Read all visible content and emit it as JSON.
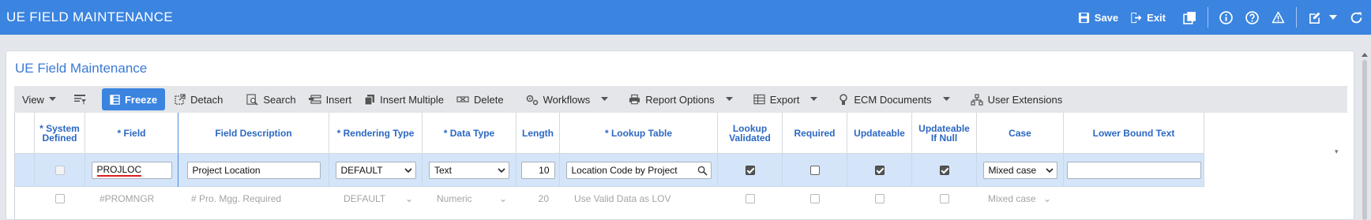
{
  "app": {
    "title": "UE FIELD MAINTENANCE"
  },
  "topbar": {
    "save_label": "Save",
    "exit_label": "Exit"
  },
  "panel": {
    "title": "UE Field Maintenance"
  },
  "toolbar": {
    "view": "View",
    "freeze": "Freeze",
    "detach": "Detach",
    "search": "Search",
    "insert": "Insert",
    "insert_multiple": "Insert Multiple",
    "delete": "Delete",
    "workflows": "Workflows",
    "report_options": "Report Options",
    "export": "Export",
    "ecm_documents": "ECM Documents",
    "user_extensions": "User Extensions"
  },
  "grid": {
    "headers": {
      "system_defined": "* System Defined",
      "field": "* Field",
      "field_description": "Field Description",
      "rendering_type": "* Rendering Type",
      "data_type": "* Data Type",
      "length": "Length",
      "lookup_table": "* Lookup Table",
      "lookup_validated": "Lookup Validated",
      "required": "Required",
      "updateable": "Updateable",
      "updateable_if_null": "Updateable If Null",
      "case": "Case",
      "lower_bound_text": "Lower Bound Text"
    },
    "rows": [
      {
        "system_defined": false,
        "field": "PROJLOC",
        "field_description": "Project Location",
        "rendering_type": "DEFAULT",
        "data_type": "Text",
        "length": "10",
        "lookup_table": "Location Code by Project",
        "lookup_validated": true,
        "required": false,
        "updateable": true,
        "updateable_if_null": true,
        "case": "Mixed case",
        "lower_bound_text": ""
      },
      {
        "system_defined": false,
        "field": "#PROMNGR",
        "field_description": "# Pro. Mgg. Required",
        "rendering_type": "DEFAULT",
        "data_type": "Numeric",
        "length": "20",
        "lookup_table": "Use Valid Data as LOV",
        "lookup_validated": false,
        "required": false,
        "updateable": false,
        "updateable_if_null": false,
        "case": "Mixed case",
        "lower_bound_text": ""
      }
    ]
  },
  "colors": {
    "accent": "#3b84e0",
    "header_text": "#2b68c2",
    "selected_row": "#d4e5f9",
    "underline": "#d81e1e"
  }
}
